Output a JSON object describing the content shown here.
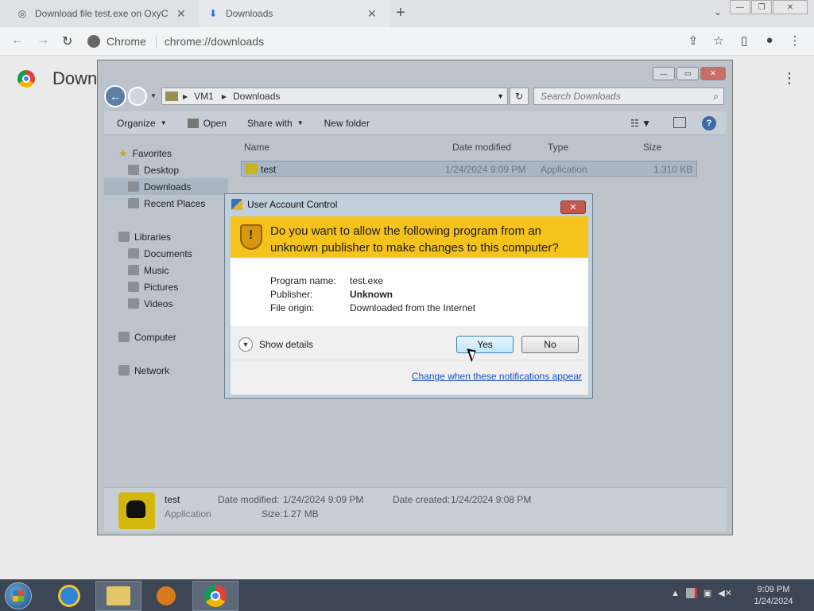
{
  "chrome": {
    "tabs": [
      {
        "title": "Download file test.exe on OxyC",
        "active": false
      },
      {
        "title": "Downloads",
        "active": true
      }
    ],
    "omnibox": {
      "site": "Chrome",
      "url": "chrome://downloads"
    },
    "page_title": "Down"
  },
  "explorer": {
    "breadcrumb": [
      "VM1",
      "Downloads"
    ],
    "search_placeholder": "Search Downloads",
    "commands": [
      "Organize",
      "Open",
      "Share with",
      "New folder"
    ],
    "nav": {
      "favorites": "Favorites",
      "favorite_items": [
        "Desktop",
        "Downloads",
        "Recent Places"
      ],
      "libraries": "Libraries",
      "library_items": [
        "Documents",
        "Music",
        "Pictures",
        "Videos"
      ],
      "computer": "Computer",
      "network": "Network"
    },
    "columns": [
      "Name",
      "Date modified",
      "Type",
      "Size"
    ],
    "file": {
      "name": "test",
      "date_modified": "1/24/2024 9:09 PM",
      "type": "Application",
      "size": "1,310 KB"
    },
    "details": {
      "name": "test",
      "type": "Application",
      "date_modified_label": "Date modified:",
      "date_modified": "1/24/2024 9:09 PM",
      "date_created_label": "Date created:",
      "date_created": "1/24/2024 9:08 PM",
      "size_label": "Size:",
      "size": "1.27 MB"
    }
  },
  "uac": {
    "title": "User Account Control",
    "question": "Do you want to allow the following program from an unknown publisher to make changes to this computer?",
    "program_name_label": "Program name:",
    "program_name": "test.exe",
    "publisher_label": "Publisher:",
    "publisher": "Unknown",
    "file_origin_label": "File origin:",
    "file_origin": "Downloaded from the Internet",
    "show_details": "Show details",
    "yes": "Yes",
    "no": "No",
    "link": "Change when these notifications appear"
  },
  "taskbar": {
    "time": "9:09 PM",
    "date": "1/24/2024"
  }
}
